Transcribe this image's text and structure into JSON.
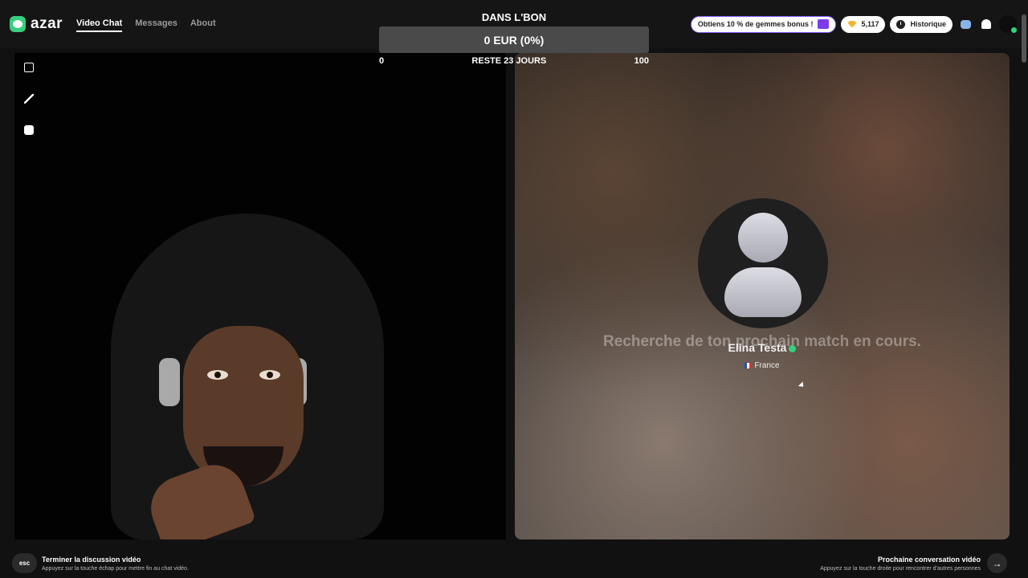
{
  "header": {
    "brand": "azar",
    "nav": [
      "Video Chat",
      "Messages",
      "About"
    ],
    "promo": "Obtiens 10 % de gemmes bonus !",
    "gems": "5,117",
    "history": "Historique"
  },
  "goal": {
    "title": "DANS L'BON",
    "amount": "0 EUR (0%)",
    "min": "0",
    "remaining": "RESTE 23 JOURS",
    "max": "100",
    "progress_percent": 0
  },
  "match": {
    "searching_text": "Recherche de ton prochain match en cours.",
    "name": "Elina Testa",
    "country": "France"
  },
  "footer": {
    "esc_key": "esc",
    "end_title": "Terminer la discussion vidéo",
    "end_sub": "Appuyez sur la touche échap pour mettre fin au chat vidéo.",
    "next_title": "Prochaine conversation vidéo",
    "next_sub": "Appuyez sur la touche droite pour rencontrer d'autres personnes",
    "next_arrow": "→"
  },
  "colors": {
    "brand": "#35d07f",
    "promo_border": "#8a5cf6",
    "gem": "#f5b52e"
  }
}
